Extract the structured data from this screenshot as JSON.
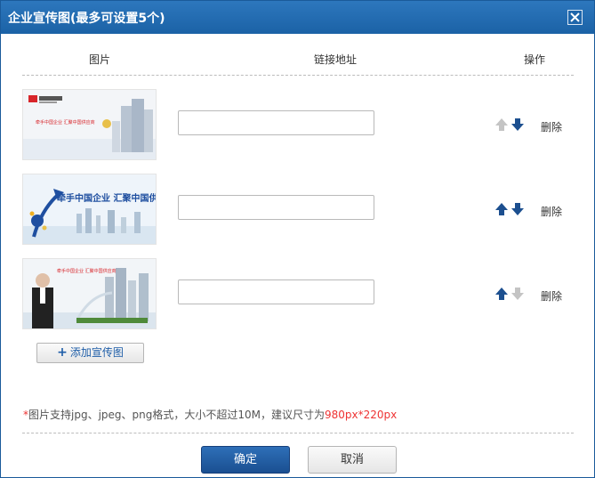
{
  "dialog": {
    "title": "企业宣传图(最多可设置5个)",
    "close_icon": "close-icon"
  },
  "table": {
    "headers": {
      "image": "图片",
      "link": "链接地址",
      "action": "操作"
    },
    "rows": [
      {
        "banner_logo": "中国供应商",
        "banner_slogan": "牵手中国企业 汇聚中国供应商",
        "link_value": "",
        "up_enabled": false,
        "down_enabled": true,
        "delete_label": "删除"
      },
      {
        "banner_slogan": "牵手中国企业 汇聚中国供应商",
        "link_value": "",
        "up_enabled": true,
        "down_enabled": true,
        "delete_label": "删除"
      },
      {
        "banner_slogan": "牵手中国企业 汇聚中国供应商",
        "link_value": "",
        "up_enabled": true,
        "down_enabled": false,
        "delete_label": "删除"
      }
    ]
  },
  "add_button": {
    "label": "添加宣传图",
    "icon": "plus-icon"
  },
  "note": {
    "star": "*",
    "text": "图片支持jpg、jpeg、png格式，大小不超过10M，建议尺寸为",
    "size": "980px*220px"
  },
  "footer": {
    "confirm": "确定",
    "cancel": "取消"
  },
  "colors": {
    "title_bar": "#1f66ab",
    "arrow_active": "#1c4f8f",
    "arrow_disabled": "#c4c4c4",
    "note_highlight": "#e33333",
    "confirm_button": "#1f5ea8"
  }
}
